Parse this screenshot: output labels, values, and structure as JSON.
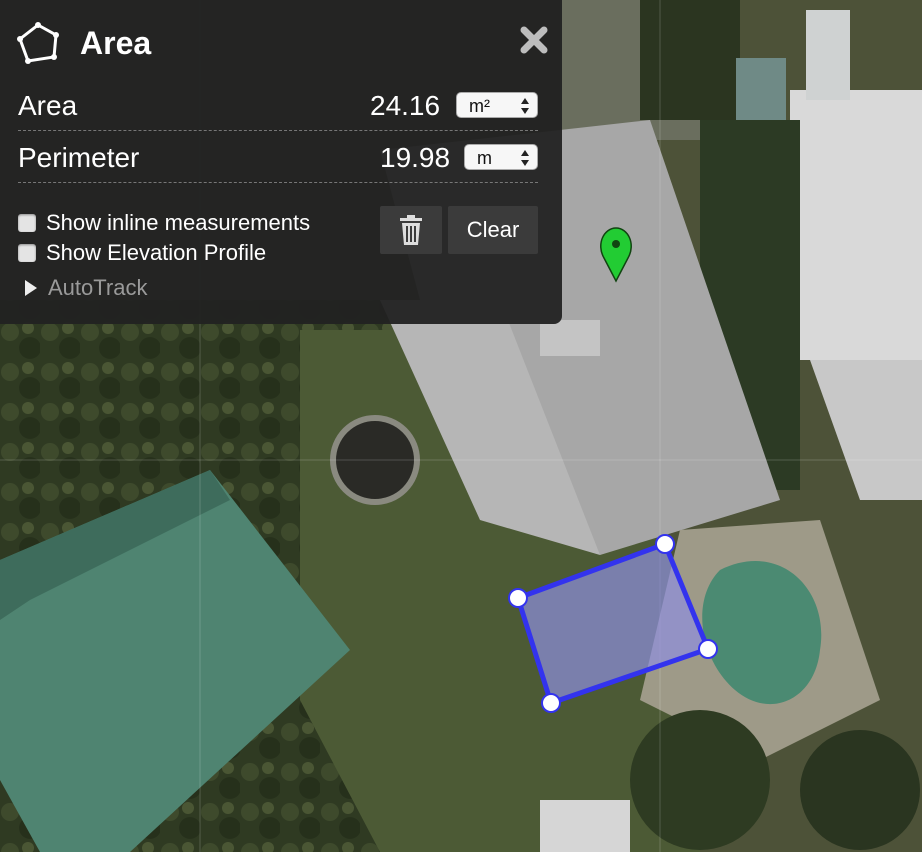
{
  "panel": {
    "title": "Area",
    "title_icon": "polygon-icon",
    "close_icon": "close-icon",
    "area": {
      "label": "Area",
      "value": "24.16",
      "unit": "m²"
    },
    "perimeter": {
      "label": "Perimeter",
      "value": "19.98",
      "unit": "m"
    },
    "options": {
      "inline": "Show inline measurements",
      "elevation": "Show Elevation Profile"
    },
    "delete_icon": "trash-icon",
    "clear_label": "Clear",
    "autotrack_label": "AutoTrack"
  },
  "map": {
    "placemark_icon": "green-placemark-icon",
    "polygon_color": "#3333ee",
    "polygon_fill": "#8e8ee0",
    "placemark_color": "#22cc33"
  }
}
